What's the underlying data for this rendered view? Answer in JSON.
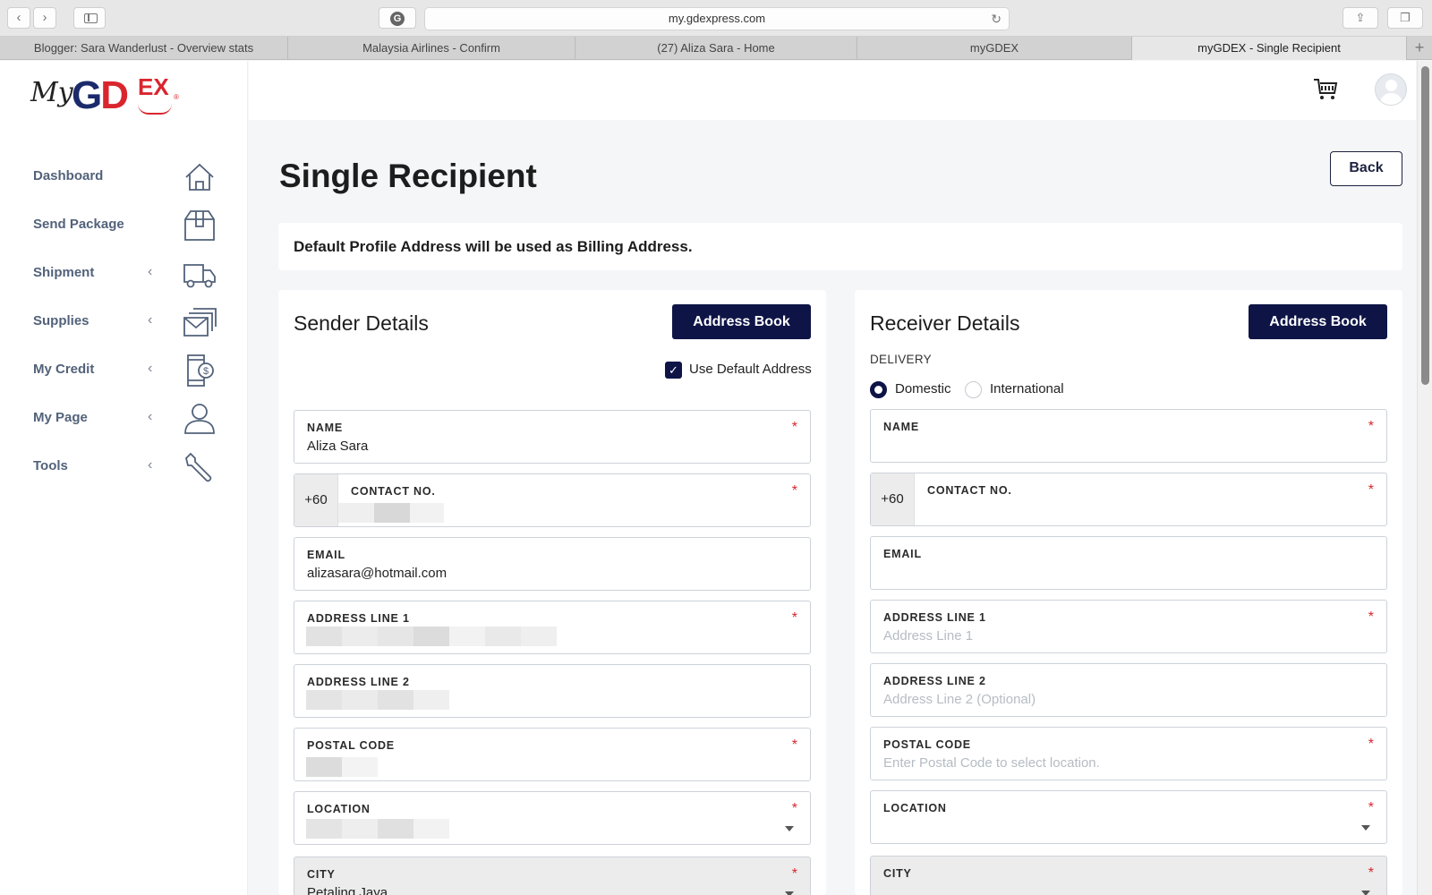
{
  "browser": {
    "url": "my.gdexpress.com",
    "tabs": [
      "Blogger: Sara Wanderlust - Overview stats",
      "Malaysia Airlines - Confirm",
      "(27) Aliza Sara - Home",
      "myGDEX",
      "myGDEX - Single Recipient"
    ]
  },
  "logo": {
    "my": "My",
    "g": "G",
    "d": "D",
    "ex": "EX",
    "tm": "®"
  },
  "sidebar": {
    "items": [
      {
        "label": "Dashboard",
        "icon": "home-icon",
        "chevron": false
      },
      {
        "label": "Send Package",
        "icon": "box-icon",
        "chevron": false
      },
      {
        "label": "Shipment",
        "icon": "truck-icon",
        "chevron": true
      },
      {
        "label": "Supplies",
        "icon": "envelope-stack-icon",
        "chevron": true
      },
      {
        "label": "My Credit",
        "icon": "phone-dollar-icon",
        "chevron": true
      },
      {
        "label": "My Page",
        "icon": "user-icon",
        "chevron": true
      },
      {
        "label": "Tools",
        "icon": "wrench-icon",
        "chevron": true
      }
    ]
  },
  "page": {
    "title": "Single Recipient",
    "back_label": "Back",
    "notice": "Default Profile Address will be used as Billing Address."
  },
  "sender": {
    "title": "Sender Details",
    "address_book_label": "Address Book",
    "use_default_label": "Use Default Address",
    "use_default_checked": true,
    "fields": {
      "name": {
        "label": "NAME",
        "value": "Aliza Sara",
        "required": true
      },
      "contact": {
        "label": "CONTACT NO.",
        "prefix": "+60",
        "required": true
      },
      "email": {
        "label": "EMAIL",
        "value": "alizasara@hotmail.com",
        "required": false
      },
      "address1": {
        "label": "ADDRESS LINE 1",
        "required": true
      },
      "address2": {
        "label": "ADDRESS LINE 2",
        "required": false
      },
      "postal": {
        "label": "POSTAL CODE",
        "required": true
      },
      "location": {
        "label": "LOCATION",
        "required": true
      },
      "city": {
        "label": "CITY",
        "value": "Petaling Jaya",
        "required": true
      }
    }
  },
  "receiver": {
    "title": "Receiver Details",
    "address_book_label": "Address Book",
    "delivery_label": "DELIVERY",
    "delivery_options": [
      "Domestic",
      "International"
    ],
    "delivery_selected": "Domestic",
    "fields": {
      "name": {
        "label": "NAME",
        "required": true
      },
      "contact": {
        "label": "CONTACT NO.",
        "prefix": "+60",
        "required": true
      },
      "email": {
        "label": "EMAIL",
        "required": false
      },
      "address1": {
        "label": "ADDRESS LINE 1",
        "placeholder": "Address Line 1",
        "required": true
      },
      "address2": {
        "label": "ADDRESS LINE 2",
        "placeholder": "Address Line 2 (Optional)",
        "required": false
      },
      "postal": {
        "label": "POSTAL CODE",
        "placeholder": "Enter Postal Code to select location.",
        "required": true
      },
      "location": {
        "label": "LOCATION",
        "required": true
      },
      "city": {
        "label": "CITY",
        "required": true
      }
    }
  },
  "required_mark": "*",
  "colors": {
    "navy": "#0e1446",
    "brand_red": "#d9262e",
    "brand_blue": "#1b2a6b",
    "sidebar_text": "#52627a"
  }
}
